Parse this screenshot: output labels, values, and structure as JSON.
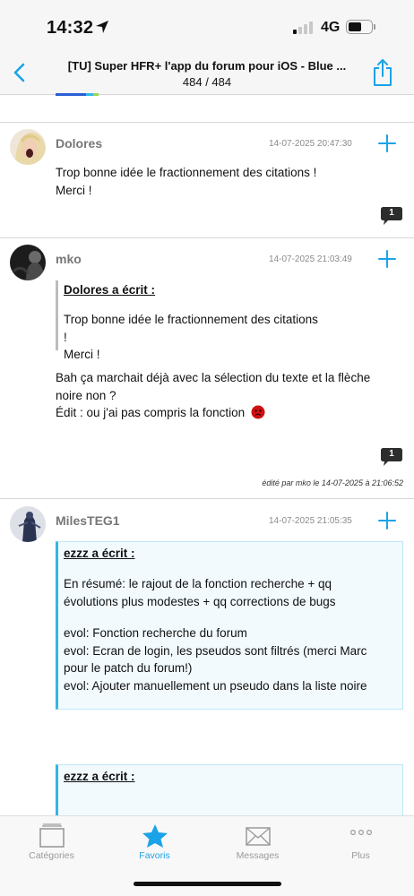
{
  "status": {
    "time": "14:32",
    "network": "4G"
  },
  "nav": {
    "title": "[TU] Super HFR+ l'app du forum pour iOS - Blue ...",
    "pages": "484 / 484"
  },
  "colors": {
    "accent": "#1aa3e8",
    "quote_border": "#33b5e5",
    "quote_bg": "#f2fafe"
  },
  "posts": [
    {
      "author": "Dolores",
      "date": "14-07-2025 20:47:30",
      "lines": [
        "Trop bonne idée le fractionnement des citations !",
        "Merci !"
      ],
      "bubble_count": "1"
    },
    {
      "author": "mko",
      "date": "14-07-2025 21:03:49",
      "quote": {
        "header": "Dolores a écrit :",
        "lines": [
          "Trop bonne idée le fractionnement des citations !",
          "Merci !"
        ]
      },
      "lines": [
        "Bah ça marchait déjà avec la sélection du texte et la flèche",
        "noire non ?",
        "Édit : ou j'ai pas compris la fonction"
      ],
      "bubble_count": "1",
      "edited": "édité par mko le 14-07-2025 à 21:06:52"
    },
    {
      "author": "MilesTEG1",
      "date": "14-07-2025 21:05:35",
      "quote": {
        "header": "ezzz a écrit :",
        "lines": [
          "En résumé: le rajout de la fonction recherche + qq",
          "évolutions plus modestes + qq corrections de bugs",
          "",
          "evol: Fonction recherche du forum",
          "evol: Ecran de login, les pseudos sont filtrés (merci Marc",
          "pour le patch du forum!)",
          "evol: Ajouter manuellement un pseudo dans la liste noire"
        ]
      },
      "quote2": {
        "header": "ezzz a écrit :"
      }
    }
  ],
  "tabs": [
    {
      "label": "Catégories",
      "icon": "categories-icon",
      "active": false
    },
    {
      "label": "Favoris",
      "icon": "star-icon",
      "active": true
    },
    {
      "label": "Messages",
      "icon": "envelope-icon",
      "active": false
    },
    {
      "label": "Plus",
      "icon": "more-icon",
      "active": false
    }
  ]
}
